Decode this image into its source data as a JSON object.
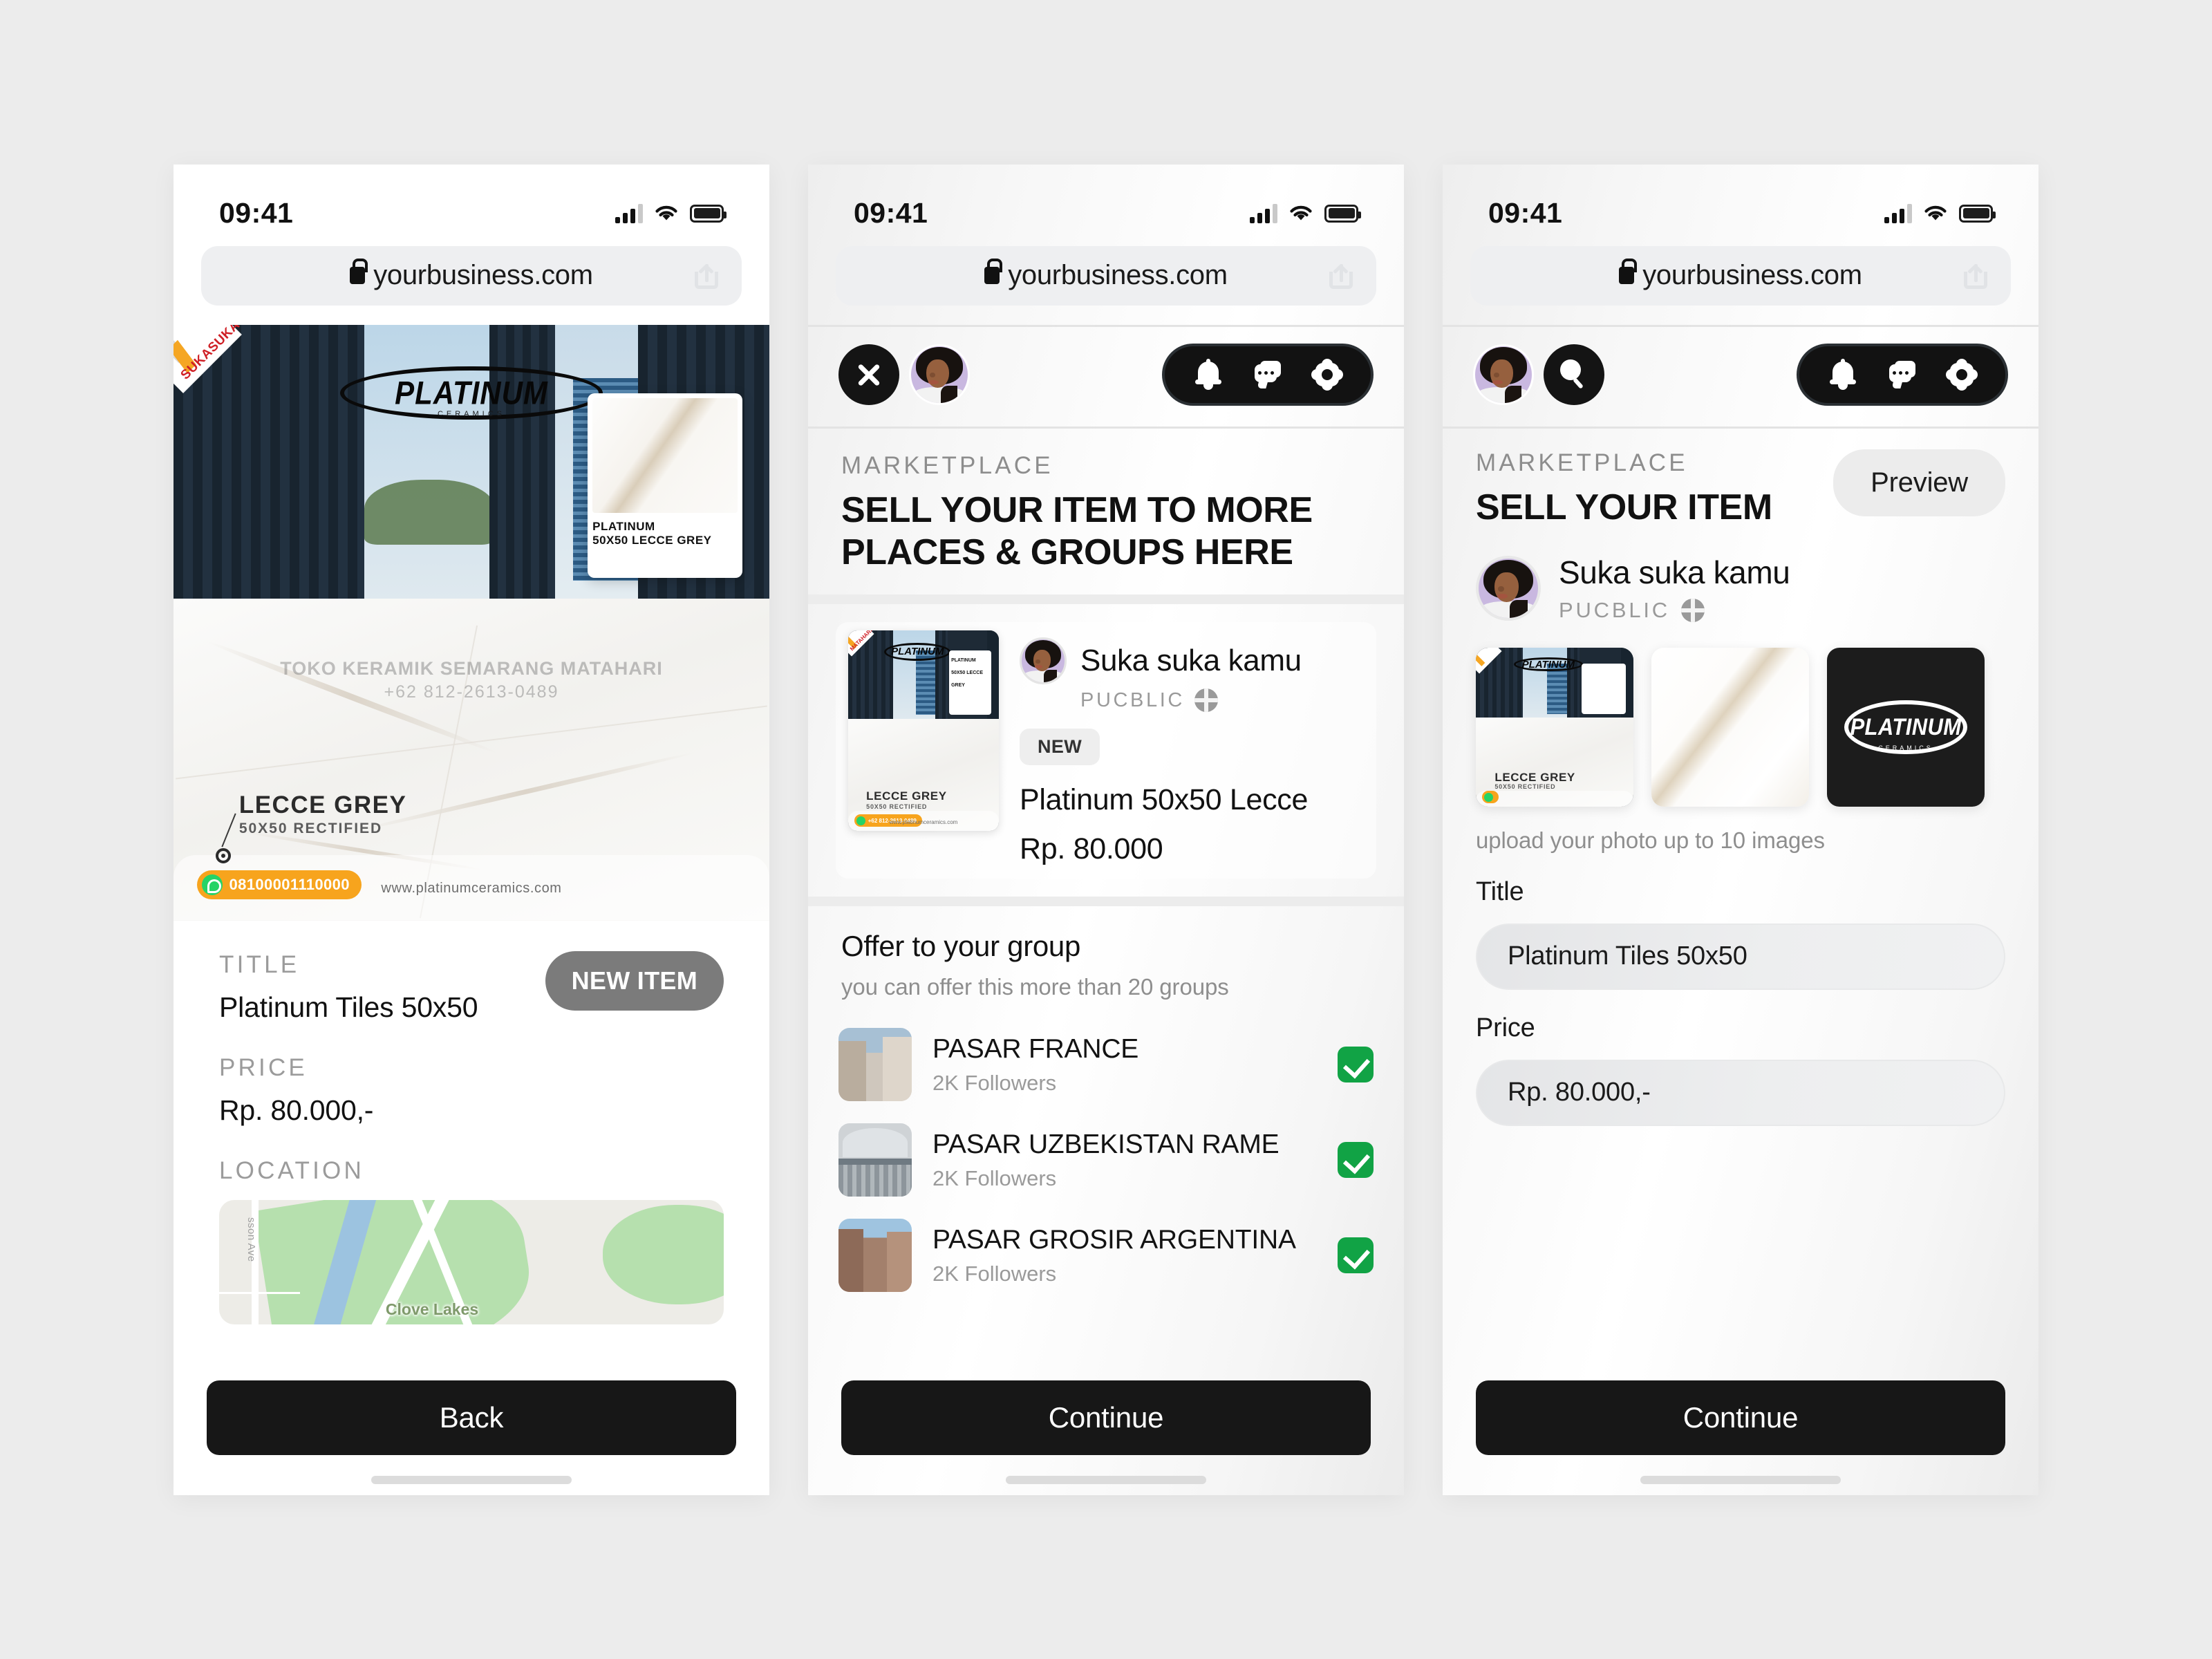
{
  "statusbar": {
    "time": "09:41"
  },
  "browser": {
    "url": "yourbusiness.com",
    "lock_icon": "lock-icon",
    "share_icon": "share-icon"
  },
  "screen1": {
    "hero": {
      "corner_tag": "SUKASUKA",
      "brand": "PLATINUM",
      "brand_sub": "CERAMICS",
      "swatch_line1": "PLATINUM",
      "swatch_line2": "50X50 LECCE GREY",
      "watermark_line1": "TOKO KERAMIK SEMARANG MATAHARI",
      "watermark_line2": "+62 812-2613-0489",
      "callout_title": "LECCE GREY",
      "callout_sub": "50X50 RECTIFIED",
      "whatsapp_number": "08100001110000",
      "website": "www.platinumceramics.com"
    },
    "title_label": "TITLE",
    "title_value": "Platinum Tiles 50x50",
    "new_item_badge": "NEW ITEM",
    "price_label": "PRICE",
    "price_value": "Rp. 80.000,-",
    "location_label": "LOCATION",
    "map": {
      "place_label": "Clove Lakes",
      "street_label": "sson Ave"
    },
    "cta": "Back"
  },
  "screen2": {
    "header": {
      "close_icon": "close-icon",
      "avatar": "user-avatar",
      "actions": [
        "bell-icon",
        "chat-icon",
        "gear-icon"
      ]
    },
    "eyebrow": "MARKETPLACE",
    "headline": "SELL YOUR ITEM TO MORE PLACES & GROUPS HERE",
    "product": {
      "seller_name": "Suka suka kamu",
      "visibility": "PUCBLIC",
      "visibility_icon": "globe-icon",
      "badge": "NEW",
      "title": "Platinum 50x50 Lecce",
      "price": "Rp. 80.000",
      "thumb_brand": "PLATINUM",
      "thumb_callout": "LECCE GREY",
      "thumb_callout_sub": "50X50 RECTIFIED",
      "thumb_swatch1": "PLATINUM",
      "thumb_swatch2": "50X50 LECCE GREY",
      "thumb_corner_tag": "MATAHARI",
      "thumb_phone": "+62 812-2613-0489",
      "thumb_site": "www.platinumceramics.com"
    },
    "offer_title": "Offer to your group",
    "offer_sub": "you can offer this more than 20 groups",
    "groups": [
      {
        "name": "PASAR FRANCE",
        "followers": "2K Followers",
        "selected": true
      },
      {
        "name": "PASAR UZBEKISTAN RAME",
        "followers": "2K Followers",
        "selected": true
      },
      {
        "name": "PASAR GROSIR ARGENTINA",
        "followers": "2K Followers",
        "selected": true
      }
    ],
    "cta": "Continue"
  },
  "screen3": {
    "header": {
      "avatar": "user-avatar",
      "search_icon": "search-icon",
      "actions": [
        "bell-icon",
        "chat-icon",
        "gear-icon"
      ]
    },
    "eyebrow": "MARKETPLACE",
    "headline": "SELL YOUR ITEM",
    "preview_button": "Preview",
    "seller_name": "Suka suka kamu",
    "visibility": "PUCBLIC",
    "visibility_icon": "globe-icon",
    "gallery_brand": "PLATINUM",
    "gallery_brand_sub": "CERAMICS",
    "gallery_thumb_callout": "LECCE GREY",
    "gallery_thumb_callout_sub": "50X50 RECTIFIED",
    "upload_hint": "upload your photo up to 10 images",
    "title_label": "Title",
    "title_value": "Platinum Tiles 50x50",
    "price_label": "Price",
    "price_value": "Rp. 80.000,-",
    "cta": "Continue"
  },
  "colors": {
    "background": "#ececec",
    "cta_dark": "#171717",
    "check_green": "#11a345",
    "badge_grey": "#7b7b7b",
    "accent_orange": "#f7a41d"
  }
}
